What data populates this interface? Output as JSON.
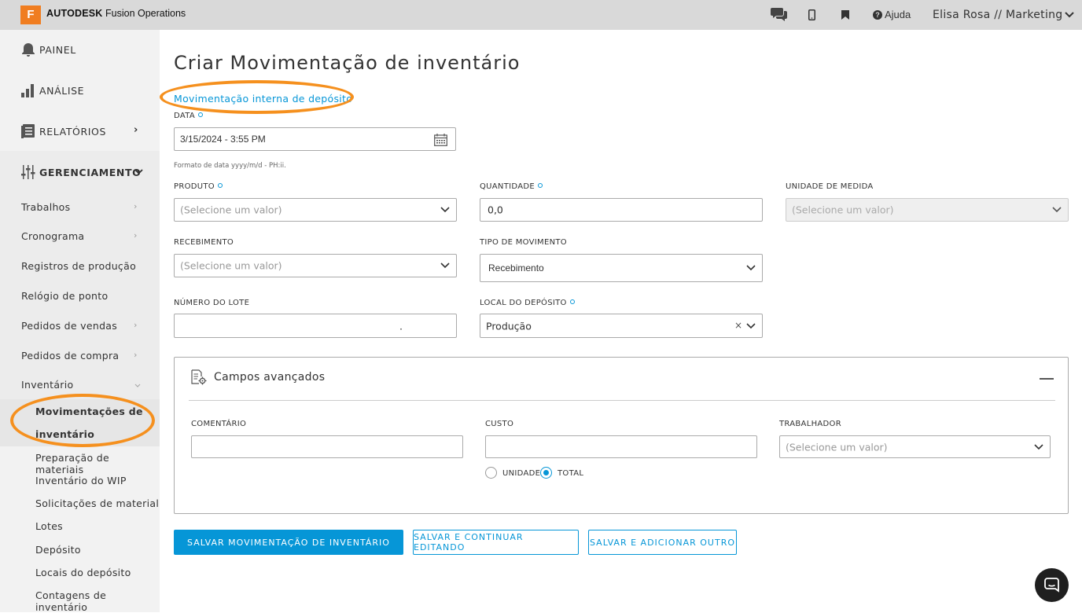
{
  "topbar": {
    "logo_letter": "F",
    "brand_bold": "AUTODESK",
    "brand_rest": " Fusion Operations",
    "help_label": "Ajuda",
    "user_label": "Elisa Rosa // Marketing",
    "icons": [
      "chat-icon",
      "mobile-icon",
      "bookmark-icon",
      "help-icon",
      "chevron-down-icon"
    ]
  },
  "sidebar": {
    "main_items": [
      {
        "label": "PAINEL",
        "icon": "bell-icon"
      },
      {
        "label": "ANÁLISE",
        "icon": "bar-chart-icon"
      },
      {
        "label": "RELATÓRIOS",
        "icon": "reports-icon"
      },
      {
        "label": "GERENCIAMENTO",
        "icon": "sliders-icon"
      }
    ],
    "sub_items": [
      {
        "label": "Trabalhos"
      },
      {
        "label": "Cronograma"
      },
      {
        "label": "Registros de produção"
      },
      {
        "label": "Relógio de ponto"
      },
      {
        "label": "Pedidos de vendas"
      },
      {
        "label": "Pedidos de compra"
      },
      {
        "label": "Inventário"
      }
    ],
    "inventory_items": [
      {
        "label": "Movimentações de"
      },
      {
        "label": "inventário"
      },
      {
        "label": "Preparação de materiais"
      },
      {
        "label": "Inventário do WIP"
      },
      {
        "label": "Solicitações de material"
      },
      {
        "label": "Lotes"
      },
      {
        "label": "Depósito"
      },
      {
        "label": "Locais do depósito"
      },
      {
        "label": "Contagens de inventário"
      }
    ]
  },
  "main": {
    "title": "Criar Movimentação de inventário",
    "subtitle_link": "Movimentação interna de depósito",
    "date": {
      "label": "DATA",
      "value": "3/15/2024 - 3:55 PM",
      "hint": "Formato de data yyyy/m/d - PH:ii."
    },
    "produto": {
      "label": "PRODUTO",
      "placeholder": "(Selecione um valor)"
    },
    "quantidade": {
      "label": "QUANTIDADE",
      "value": "0,0"
    },
    "unidade": {
      "label": "UNIDADE DE MEDIDA",
      "placeholder": "(Selecione um valor)"
    },
    "recebimento": {
      "label": "RECEBIMENTO",
      "placeholder": "(Selecione um valor)"
    },
    "tipo": {
      "label": "TIPO DE MOVIMENTO",
      "value": "Recebimento"
    },
    "lote": {
      "label": "NÚMERO DO LOTE",
      "value": "."
    },
    "local": {
      "label": "LOCAL DO DEPÓSITO",
      "value": "Produção",
      "clear": "×"
    },
    "advanced": {
      "title": "Campos avançados",
      "comentario": {
        "label": "COMENTÁRIO",
        "value": ""
      },
      "custo": {
        "label": "CUSTO",
        "value": ""
      },
      "trabalhador": {
        "label": "TRABALHADOR",
        "placeholder": "(Selecione um valor)"
      },
      "radio_unidade": "UNIDADE",
      "radio_total": "TOTAL",
      "selected": "TOTAL"
    },
    "buttons": {
      "save": "SALVAR MOVIMENTAÇÃO DE INVENTÁRIO",
      "save_continue": "SALVAR E CONTINUAR EDITANDO",
      "save_add": "SALVAR E ADICIONAR OUTRO"
    }
  },
  "colors": {
    "accent": "#0696d7",
    "annotation": "#f5901e",
    "logo": "#f07d20"
  }
}
